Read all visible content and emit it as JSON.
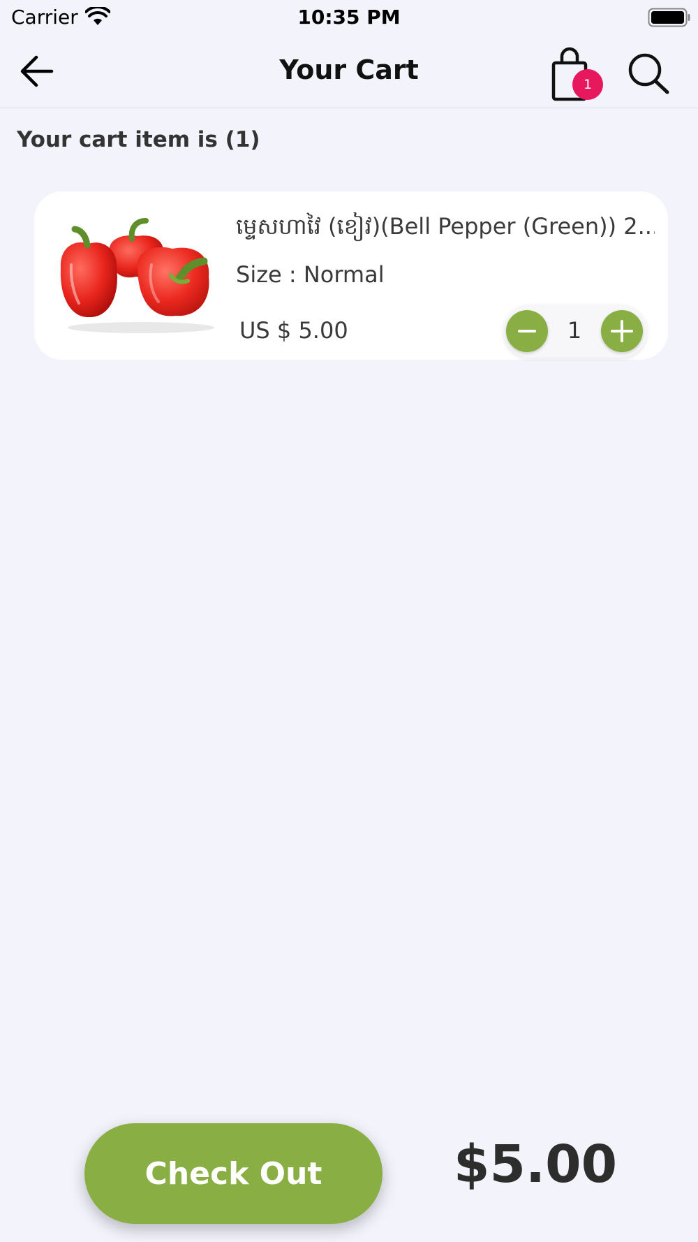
{
  "status_bar": {
    "carrier": "Carrier",
    "time": "10:35 PM"
  },
  "nav": {
    "title": "Your Cart",
    "cart_badge_count": "1",
    "icons": [
      "back-arrow-icon",
      "shopping-bag-icon",
      "search-icon"
    ]
  },
  "cart": {
    "count_label": "Your cart item is (1)",
    "items": [
      {
        "name": "ម្ទេសហាវៃ (ខៀវ)(Bell Pepper (Green)) 2...",
        "size": "Size : Normal",
        "price": "US $ 5.00",
        "quantity": "1",
        "image": "red-bell-peppers"
      }
    ]
  },
  "footer": {
    "checkout_label": "Check Out",
    "total": "$5.00"
  },
  "colors": {
    "accent_green": "#88ae44",
    "badge_pink": "#e8185e",
    "background": "#f2f3fb"
  }
}
